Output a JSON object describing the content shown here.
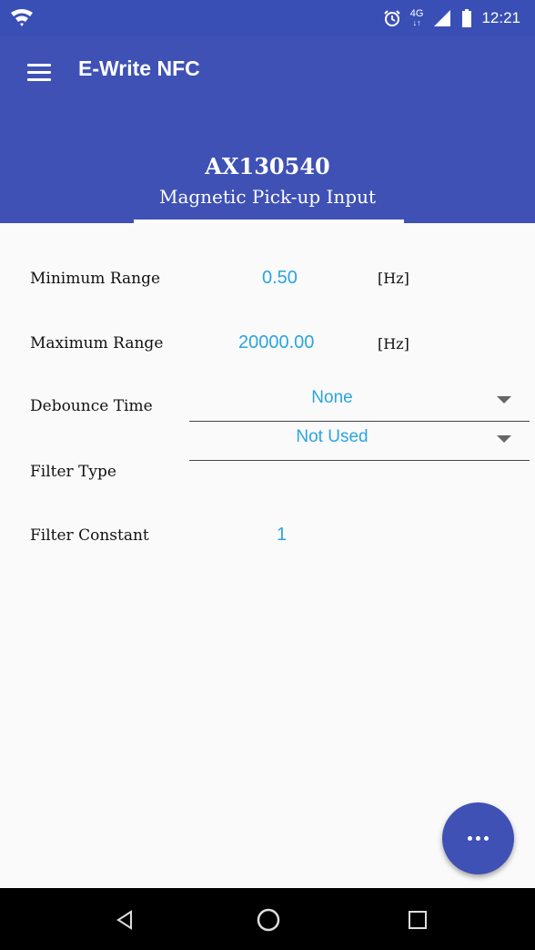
{
  "status_bar": {
    "network": "4G",
    "time": "12:21",
    "icons": [
      "wifi-icon",
      "alarm-icon",
      "signal-icon",
      "battery-icon"
    ]
  },
  "app_bar": {
    "title": "E-Write NFC",
    "menu_icon": "hamburger-menu-icon"
  },
  "header": {
    "device_id": "AX130540",
    "input_type": "Magnetic Pick-up Input"
  },
  "fields": {
    "minimum_range": {
      "label": "Minimum Range",
      "value": "0.50",
      "unit": "[Hz]"
    },
    "maximum_range": {
      "label": "Maximum Range",
      "value": "20000.00",
      "unit": "[Hz]"
    },
    "debounce_time": {
      "label": "Debounce Time",
      "selected": "None"
    },
    "filter_type": {
      "label": "Filter Type",
      "selected": "Not Used"
    },
    "filter_constant": {
      "label": "Filter Constant",
      "value": "1"
    }
  },
  "fab": {
    "icon": "more-horizontal-icon"
  },
  "nav_bar": {
    "icons": [
      "back-icon",
      "home-icon",
      "recents-icon"
    ]
  },
  "colors": {
    "primary": "#3f51b5",
    "status_bar": "#3a4fb5",
    "value_text": "#2aa5e0",
    "background": "#fafafa"
  }
}
